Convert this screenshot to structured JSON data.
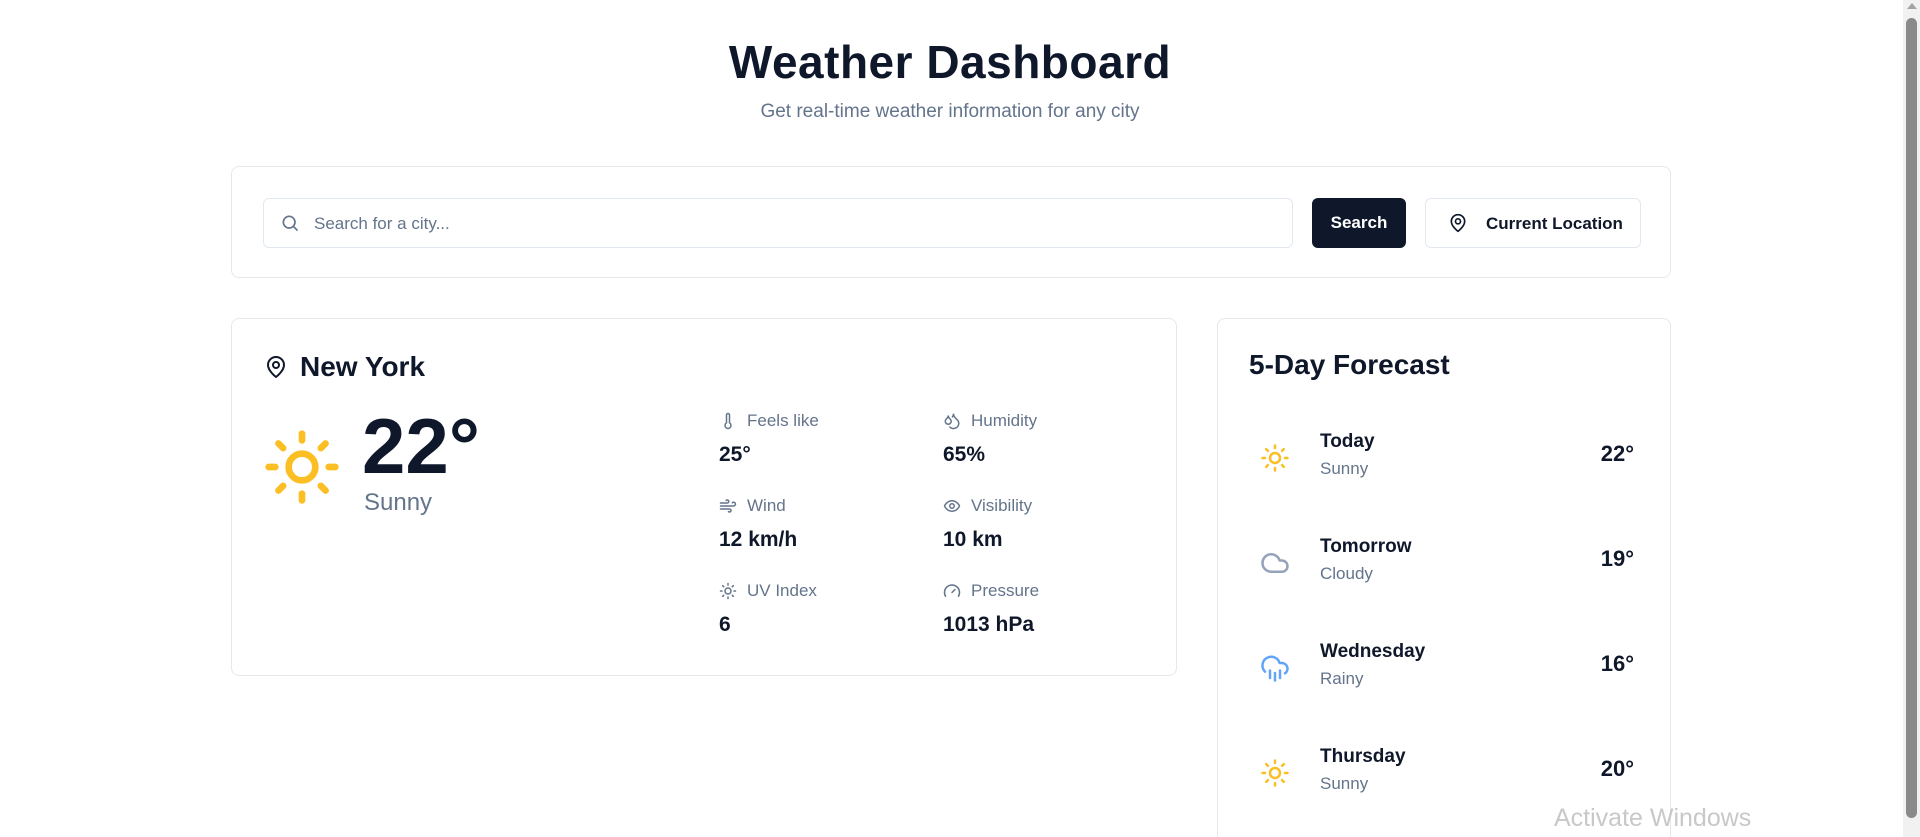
{
  "header": {
    "title": "Weather Dashboard",
    "subtitle": "Get real-time weather information for any city"
  },
  "search": {
    "placeholder": "Search for a city...",
    "search_label": "Search",
    "location_label": "Current Location"
  },
  "current": {
    "city": "New York",
    "temperature": "22°",
    "condition": "Sunny",
    "icon": "sun-icon",
    "details": [
      {
        "label": "Feels like",
        "value": "25°",
        "icon": "thermometer-icon"
      },
      {
        "label": "Humidity",
        "value": "65%",
        "icon": "droplets-icon"
      },
      {
        "label": "Wind",
        "value": "12 km/h",
        "icon": "wind-icon"
      },
      {
        "label": "Visibility",
        "value": "10 km",
        "icon": "eye-icon"
      },
      {
        "label": "UV Index",
        "value": "6",
        "icon": "sun-small-icon"
      },
      {
        "label": "Pressure",
        "value": "1013 hPa",
        "icon": "gauge-icon"
      }
    ]
  },
  "forecast": {
    "title": "5-Day Forecast",
    "days": [
      {
        "day": "Today",
        "condition": "Sunny",
        "temp": "22°",
        "icon": "sun-icon"
      },
      {
        "day": "Tomorrow",
        "condition": "Cloudy",
        "temp": "19°",
        "icon": "cloud-icon"
      },
      {
        "day": "Wednesday",
        "condition": "Rainy",
        "temp": "16°",
        "icon": "cloud-rain-icon"
      },
      {
        "day": "Thursday",
        "condition": "Sunny",
        "temp": "20°",
        "icon": "sun-icon"
      }
    ]
  },
  "colors": {
    "text_primary": "#0f172a",
    "text_muted": "#64748b",
    "sun": "#fbbf24",
    "cloud": "#94a3b8",
    "rain": "#60a5fa",
    "border": "#e5e7eb"
  },
  "os_overlay": {
    "watermark": "Activate Windows"
  }
}
